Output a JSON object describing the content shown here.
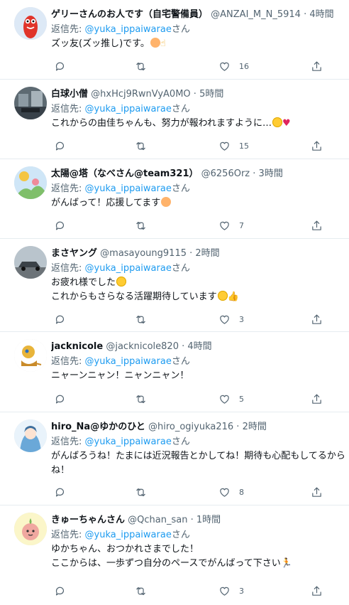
{
  "tweets": [
    {
      "name": "ゲリーさんのお人です（自宅警備員）",
      "handle": "@ANZAI_M_N_5914",
      "time": "4時間",
      "reply_prefix": "返信先: ",
      "mention": "@yuka_ippaiwarae",
      "reply_suffix": "さん",
      "text": "ズッ友(ズッ推し)です。",
      "likes": "16",
      "avatar_icon": "red-character-avatar"
    },
    {
      "name": "白球小僧",
      "handle": "@hxHcj9RwnVyA0MO",
      "time": "5時間",
      "reply_prefix": "返信先: ",
      "mention": "@yuka_ippaiwarae",
      "reply_suffix": "さん",
      "text": "これからの由佳ちゃんも、努力が報われますように…",
      "likes": "15",
      "avatar_icon": "photo-avatar"
    },
    {
      "name": "太陽@塔（なべさん@team321）",
      "handle": "@6256Orz",
      "time": "3時間",
      "reply_prefix": "返信先: ",
      "mention": "@yuka_ippaiwarae",
      "reply_suffix": "さん",
      "text": "がんばって！応援してます",
      "likes": "7",
      "avatar_icon": "illustration-avatar"
    },
    {
      "name": "まさヤング",
      "handle": "@masayoung9115",
      "time": "2時間",
      "reply_prefix": "返信先: ",
      "mention": "@yuka_ippaiwarae",
      "reply_suffix": "さん",
      "text_line1": "お疲れ様でした",
      "text_line2": "これからもさらなる活躍期待しています",
      "likes": "3",
      "avatar_icon": "car-photo-avatar"
    },
    {
      "name": "jacknicole",
      "handle": "@jacknicole820",
      "time": "4時間",
      "reply_prefix": "返信先: ",
      "mention": "@yuka_ippaiwarae",
      "reply_suffix": "さん",
      "text": "ニャーンニャン！ニャンニャン！",
      "likes": "5",
      "avatar_icon": "cat-character-avatar"
    },
    {
      "name": "hiro_Na@ゆかのひと",
      "handle": "@hiro_ogiyuka216",
      "time": "2時間",
      "reply_prefix": "返信先: ",
      "mention": "@yuka_ippaiwarae",
      "reply_suffix": "さん",
      "text_line1": "がんばろうね！たまには近況報告とかしてね！期待も心配もしてるから",
      "text_line2": "ね！",
      "likes": "8",
      "avatar_icon": "anime-girl-avatar"
    },
    {
      "name": "きゅーちゃんさん",
      "handle": "@Qchan_san",
      "time": "1時間",
      "reply_prefix": "返信先: ",
      "mention": "@yuka_ippaiwarae",
      "reply_suffix": "さん",
      "text_line1": "ゆかちゃん、おつかれさまでした！",
      "text_line2": "ここからは、一歩ずつ自分のペースでがんばって下さい",
      "likes": "3",
      "avatar_icon": "onion-character-avatar"
    }
  ],
  "colors": {
    "accent": "#1d9bf0",
    "muted": "#536471",
    "border": "#e6ecf0"
  }
}
